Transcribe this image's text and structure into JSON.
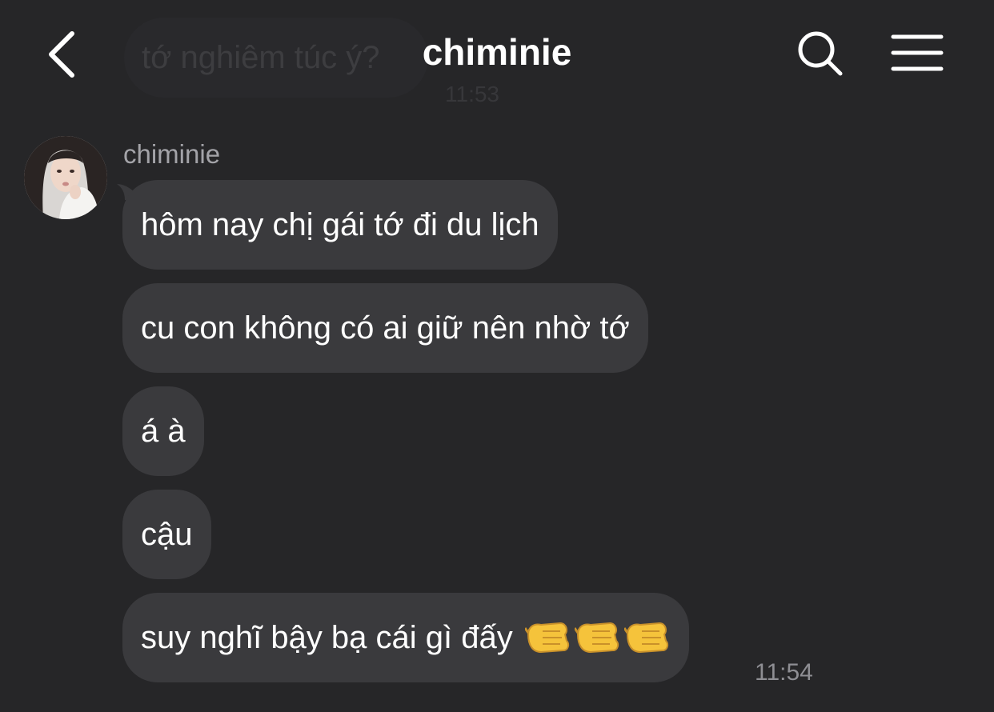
{
  "header": {
    "title": "chiminie",
    "back_icon": "chevron-left-icon",
    "search_icon": "search-icon",
    "menu_icon": "hamburger-menu-icon"
  },
  "previous_message": {
    "text": "tớ nghiêm túc ý?",
    "time": "11:53"
  },
  "conversation": {
    "sender_name": "chiminie",
    "messages": [
      {
        "text": "hôm nay chị gái tớ đi du lịch"
      },
      {
        "text": "cu con không có ai giữ nên nhờ tớ"
      },
      {
        "text": "á à"
      },
      {
        "text": "cậu"
      },
      {
        "text": "suy nghĩ bậy bạ cái gì đấy",
        "emoji": "fist-pointing-emoji",
        "emoji_count": 3
      }
    ],
    "time": "11:54"
  },
  "colors": {
    "background": "#262628",
    "bubble": "#3a3a3d",
    "text": "#ffffff",
    "secondary_text": "#a3a3a8"
  }
}
